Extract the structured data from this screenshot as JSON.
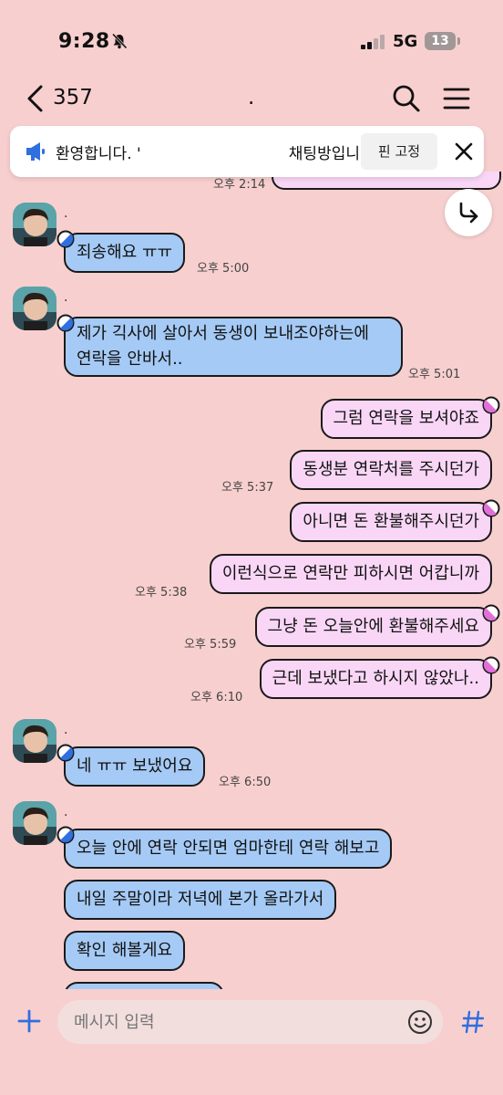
{
  "status_bar": {
    "time": "9:28",
    "network": "5G",
    "battery": "13"
  },
  "header": {
    "member_count": "357",
    "title": "."
  },
  "notice": {
    "text": "환영합니다. '                              채팅방입니다.",
    "pin_label": "핀 고정"
  },
  "partial_time": "오후 2:14",
  "sender_name": ".",
  "messages": [
    {
      "text": "죄송해요 ㅠㅠ",
      "time": "오후 5:00"
    },
    {
      "line1": "제가 긱사에 살아서 동생이 보내조야하는에",
      "line2": "연락을 안바서..",
      "time": "오후 5:01"
    },
    {
      "text": "그럼 연락을 보셔야죠"
    },
    {
      "text": "동생분 연락처를 주시던가",
      "time": "오후 5:37"
    },
    {
      "text": "아니면 돈 환불해주시던가"
    },
    {
      "text": "이런식으로 연락만 피하시면 어캅니까",
      "time": "오후 5:38"
    },
    {
      "text": "그냥 돈 오늘안에 환불해주세요",
      "time": "오후 5:59"
    },
    {
      "text": "근데 보냈다고 하시지 않았나..",
      "time": "오후 6:10"
    },
    {
      "text": "네 ㅠㅠ 보냈어요",
      "time": "오후 6:50"
    },
    {
      "text": "오늘 안에 연락 안되면 엄마한테 연락 해보고"
    },
    {
      "text": "내일 주말이라 저녁에 본가 올라가서"
    },
    {
      "text": "확인 해볼게요"
    }
  ],
  "input": {
    "placeholder": "메시지 입력"
  },
  "colors": {
    "background": "#f8cfcf",
    "incoming": "#a5caf5",
    "outgoing": "#f9d6f6",
    "accent": "#2f6fe0"
  }
}
